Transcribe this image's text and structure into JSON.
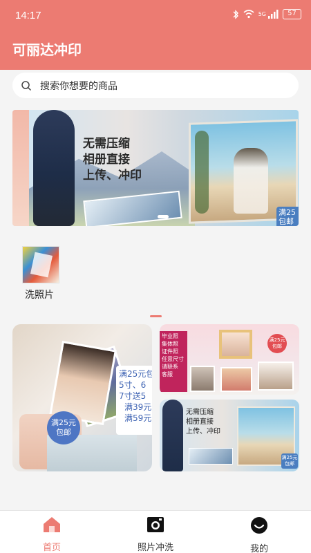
{
  "status_bar": {
    "time": "14:17",
    "network": "5G",
    "battery": "57"
  },
  "header": {
    "title": "可丽达冲印"
  },
  "search": {
    "placeholder": "搜索你想要的商品"
  },
  "banner": {
    "lines": [
      "无需压缩",
      "相册直接",
      "上传、冲印"
    ],
    "badge_line1": "满25",
    "badge_line2": "包邮"
  },
  "categories": [
    {
      "label": "洗照片"
    }
  ],
  "promo_left": {
    "price_lines": [
      "满25元包",
      "5寸、6",
      "7寸送5",
      "满39元",
      "满59元"
    ],
    "badge_line1": "满25元",
    "badge_line2": "包邮"
  },
  "promo_right_top": {
    "side_lines": [
      "毕业照",
      "集体照",
      "证件照",
      "任意尺寸",
      "请联系",
      "客服"
    ],
    "badge_line1": "满25元",
    "badge_line2": "包邮"
  },
  "promo_right_bottom": {
    "lines": [
      "无需压缩",
      "相册直接",
      "上传、冲印"
    ],
    "badge_line1": "满25元",
    "badge_line2": "包邮"
  },
  "tabbar": {
    "items": [
      {
        "label": "首页",
        "icon": "home-icon",
        "active": true
      },
      {
        "label": "照片冲洗",
        "icon": "camera-icon",
        "active": false
      },
      {
        "label": "我的",
        "icon": "smiley-icon",
        "active": false
      }
    ]
  },
  "colors": {
    "brand": "#ec7b72",
    "badge_blue": "#4e76c4",
    "badge_red": "#e24d52"
  }
}
